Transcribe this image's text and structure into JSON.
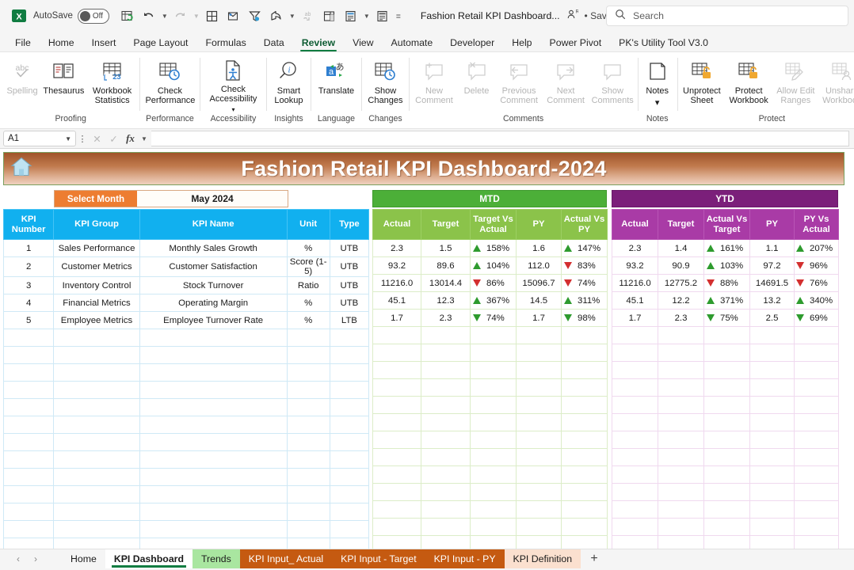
{
  "titlebar": {
    "autosave_label": "AutoSave",
    "autosave_state": "Off",
    "document_title": "Fashion Retail KPI Dashboard...",
    "save_status": "• Saving...",
    "search_placeholder": "Search",
    "quick_access": [
      {
        "name": "excel-logo-icon",
        "label": "Excel"
      },
      {
        "name": "refresh-all-icon",
        "label": "Refresh All"
      },
      {
        "name": "undo-icon",
        "label": "Undo"
      },
      {
        "name": "redo-icon",
        "label": "Redo"
      },
      {
        "name": "borders-icon",
        "label": "Borders"
      },
      {
        "name": "open-recent-icon",
        "label": "Open"
      },
      {
        "name": "filter-icon",
        "label": "Filter"
      },
      {
        "name": "share-icon",
        "label": "Share"
      },
      {
        "name": "spelling-icon",
        "label": "Spelling"
      },
      {
        "name": "freeze-panes-icon",
        "label": "Freeze Panes"
      },
      {
        "name": "calculate-now-icon",
        "label": "Calculate Now"
      },
      {
        "name": "calculate-sheet-icon",
        "label": "Calculate Sheet"
      },
      {
        "name": "customize-qat-icon",
        "label": "Customize Quick Access Toolbar"
      }
    ]
  },
  "ribbon_tabs": [
    {
      "label": "File",
      "active": false
    },
    {
      "label": "Home",
      "active": false
    },
    {
      "label": "Insert",
      "active": false
    },
    {
      "label": "Page Layout",
      "active": false
    },
    {
      "label": "Formulas",
      "active": false
    },
    {
      "label": "Data",
      "active": false
    },
    {
      "label": "Review",
      "active": true
    },
    {
      "label": "View",
      "active": false
    },
    {
      "label": "Automate",
      "active": false
    },
    {
      "label": "Developer",
      "active": false
    },
    {
      "label": "Help",
      "active": false
    },
    {
      "label": "Power Pivot",
      "active": false
    },
    {
      "label": "PK's Utility Tool V3.0",
      "active": false
    }
  ],
  "ribbon_groups": [
    {
      "name": "Proofing",
      "buttons": [
        {
          "label": "Spelling",
          "icon": "spelling-abc-icon",
          "disabled": true,
          "caret": false
        },
        {
          "label": "Thesaurus",
          "icon": "thesaurus-book-icon",
          "disabled": false,
          "caret": false
        },
        {
          "label": "Workbook Statistics",
          "icon": "workbook-statistics-icon",
          "disabled": false,
          "caret": false
        }
      ]
    },
    {
      "name": "Performance",
      "buttons": [
        {
          "label": "Check Performance",
          "icon": "check-performance-icon",
          "disabled": false,
          "caret": false
        }
      ]
    },
    {
      "name": "Accessibility",
      "buttons": [
        {
          "label": "Check Accessibility",
          "icon": "check-accessibility-icon",
          "disabled": false,
          "caret": true
        }
      ]
    },
    {
      "name": "Insights",
      "buttons": [
        {
          "label": "Smart Lookup",
          "icon": "smart-lookup-icon",
          "disabled": false,
          "caret": false
        }
      ]
    },
    {
      "name": "Language",
      "buttons": [
        {
          "label": "Translate",
          "icon": "translate-icon",
          "disabled": false,
          "caret": false
        }
      ]
    },
    {
      "name": "Changes",
      "buttons": [
        {
          "label": "Show Changes",
          "icon": "show-changes-icon",
          "disabled": false,
          "caret": false
        }
      ]
    },
    {
      "name": "Comments",
      "buttons": [
        {
          "label": "New Comment",
          "icon": "new-comment-icon",
          "disabled": true,
          "caret": false
        },
        {
          "label": "Delete",
          "icon": "delete-comment-icon",
          "disabled": true,
          "caret": false
        },
        {
          "label": "Previous Comment",
          "icon": "previous-comment-icon",
          "disabled": true,
          "caret": false
        },
        {
          "label": "Next Comment",
          "icon": "next-comment-icon",
          "disabled": true,
          "caret": false
        },
        {
          "label": "Show Comments",
          "icon": "show-comments-icon",
          "disabled": true,
          "caret": false
        }
      ]
    },
    {
      "name": "Notes",
      "buttons": [
        {
          "label": "Notes",
          "icon": "notes-icon",
          "disabled": false,
          "caret": true
        }
      ]
    },
    {
      "name": "Protect",
      "buttons": [
        {
          "label": "Unprotect Sheet",
          "icon": "unprotect-sheet-icon",
          "disabled": false,
          "caret": false
        },
        {
          "label": "Protect Workbook",
          "icon": "protect-workbook-icon",
          "disabled": false,
          "caret": false
        },
        {
          "label": "Allow Edit Ranges",
          "icon": "allow-edit-ranges-icon",
          "disabled": true,
          "caret": false
        },
        {
          "label": "Unshare Workbook",
          "icon": "unshare-workbook-icon",
          "disabled": true,
          "caret": false
        }
      ]
    }
  ],
  "formula_bar": {
    "name_box": "A1",
    "formula_value": "",
    "cancel_icon": "cancel-icon",
    "enter_icon": "enter-check-icon",
    "fx_label": "fx"
  },
  "dashboard": {
    "banner_title": "Fashion Retail KPI Dashboard-2024",
    "home_icon": "home-icon",
    "select_month_label": "Select Month",
    "select_month_value": "May 2024",
    "mtd_label": "MTD",
    "ytd_label": "YTD",
    "colors": {
      "banner_start": "#a0552a",
      "banner_end": "#efd2bf",
      "select_month": "#ed7d31",
      "mtd": "#4caf38",
      "ytd": "#7b1f7a",
      "kpi_header": "#11b0ef",
      "mtd_header": "#8bc34a",
      "ytd_header": "#a93ba6",
      "up_good": "#2e9b2e",
      "down_bad": "#d32f2f"
    }
  },
  "tables": {
    "kpi": {
      "headers": [
        "KPI Number",
        "KPI Group",
        "KPI Name",
        "Unit",
        "Type"
      ],
      "rows": [
        [
          "1",
          "Sales Performance",
          "Monthly Sales Growth",
          "%",
          "UTB"
        ],
        [
          "2",
          "Customer Metrics",
          "Customer Satisfaction",
          "Score (1-5)",
          "UTB"
        ],
        [
          "3",
          "Inventory Control",
          "Stock Turnover",
          "Ratio",
          "UTB"
        ],
        [
          "4",
          "Financial Metrics",
          "Operating Margin",
          "%",
          "UTB"
        ],
        [
          "5",
          "Employee Metrics",
          "Employee Turnover Rate",
          "%",
          "LTB"
        ]
      ]
    },
    "mtd": {
      "headers": [
        "Actual",
        "Target",
        "Target Vs Actual",
        "PY",
        "Actual Vs PY"
      ],
      "rows": [
        {
          "actual": "2.3",
          "target": "1.5",
          "tva": {
            "value": "158%",
            "dir": "up",
            "tone": "good"
          },
          "py": "1.6",
          "avp": {
            "value": "147%",
            "dir": "up",
            "tone": "good"
          }
        },
        {
          "actual": "93.2",
          "target": "89.6",
          "tva": {
            "value": "104%",
            "dir": "up",
            "tone": "good"
          },
          "py": "112.0",
          "avp": {
            "value": "83%",
            "dir": "down",
            "tone": "bad"
          }
        },
        {
          "actual": "11216.0",
          "target": "13014.4",
          "tva": {
            "value": "86%",
            "dir": "down",
            "tone": "bad"
          },
          "py": "15096.7",
          "avp": {
            "value": "74%",
            "dir": "down",
            "tone": "bad"
          }
        },
        {
          "actual": "45.1",
          "target": "12.3",
          "tva": {
            "value": "367%",
            "dir": "up",
            "tone": "good"
          },
          "py": "14.5",
          "avp": {
            "value": "311%",
            "dir": "up",
            "tone": "good"
          }
        },
        {
          "actual": "1.7",
          "target": "2.3",
          "tva": {
            "value": "74%",
            "dir": "down",
            "tone": "good"
          },
          "py": "1.7",
          "avp": {
            "value": "98%",
            "dir": "down",
            "tone": "good"
          }
        }
      ]
    },
    "ytd": {
      "headers": [
        "Actual",
        "Target",
        "Actual Vs Target",
        "PY",
        "PY Vs Actual"
      ],
      "rows": [
        {
          "actual": "2.3",
          "target": "1.4",
          "avt": {
            "value": "161%",
            "dir": "up",
            "tone": "good"
          },
          "py": "1.1",
          "pva": {
            "value": "207%",
            "dir": "up",
            "tone": "good"
          }
        },
        {
          "actual": "93.2",
          "target": "90.9",
          "avt": {
            "value": "103%",
            "dir": "up",
            "tone": "good"
          },
          "py": "97.2",
          "pva": {
            "value": "96%",
            "dir": "down",
            "tone": "bad"
          }
        },
        {
          "actual": "11216.0",
          "target": "12775.2",
          "avt": {
            "value": "88%",
            "dir": "down",
            "tone": "bad"
          },
          "py": "14691.5",
          "pva": {
            "value": "76%",
            "dir": "down",
            "tone": "bad"
          }
        },
        {
          "actual": "45.1",
          "target": "12.2",
          "avt": {
            "value": "371%",
            "dir": "up",
            "tone": "good"
          },
          "py": "13.2",
          "pva": {
            "value": "340%",
            "dir": "up",
            "tone": "good"
          }
        },
        {
          "actual": "1.7",
          "target": "2.3",
          "avt": {
            "value": "75%",
            "dir": "down",
            "tone": "good"
          },
          "py": "2.5",
          "pva": {
            "value": "69%",
            "dir": "down",
            "tone": "good"
          }
        }
      ]
    }
  },
  "sheet_tabs": {
    "prev_icon": "prev-sheet-icon",
    "next_icon": "next-sheet-icon",
    "add_label": "+",
    "items": [
      {
        "label": "Home",
        "style": "plain",
        "active": false
      },
      {
        "label": "KPI Dashboard",
        "style": "plain",
        "active": true
      },
      {
        "label": "Trends",
        "style": "green",
        "active": false
      },
      {
        "label": "KPI Input_ Actual",
        "style": "orange",
        "active": false
      },
      {
        "label": "KPI Input - Target",
        "style": "orange",
        "active": false
      },
      {
        "label": "KPI Input - PY",
        "style": "orange",
        "active": false
      },
      {
        "label": "KPI Definition",
        "style": "peach",
        "active": false
      }
    ]
  }
}
